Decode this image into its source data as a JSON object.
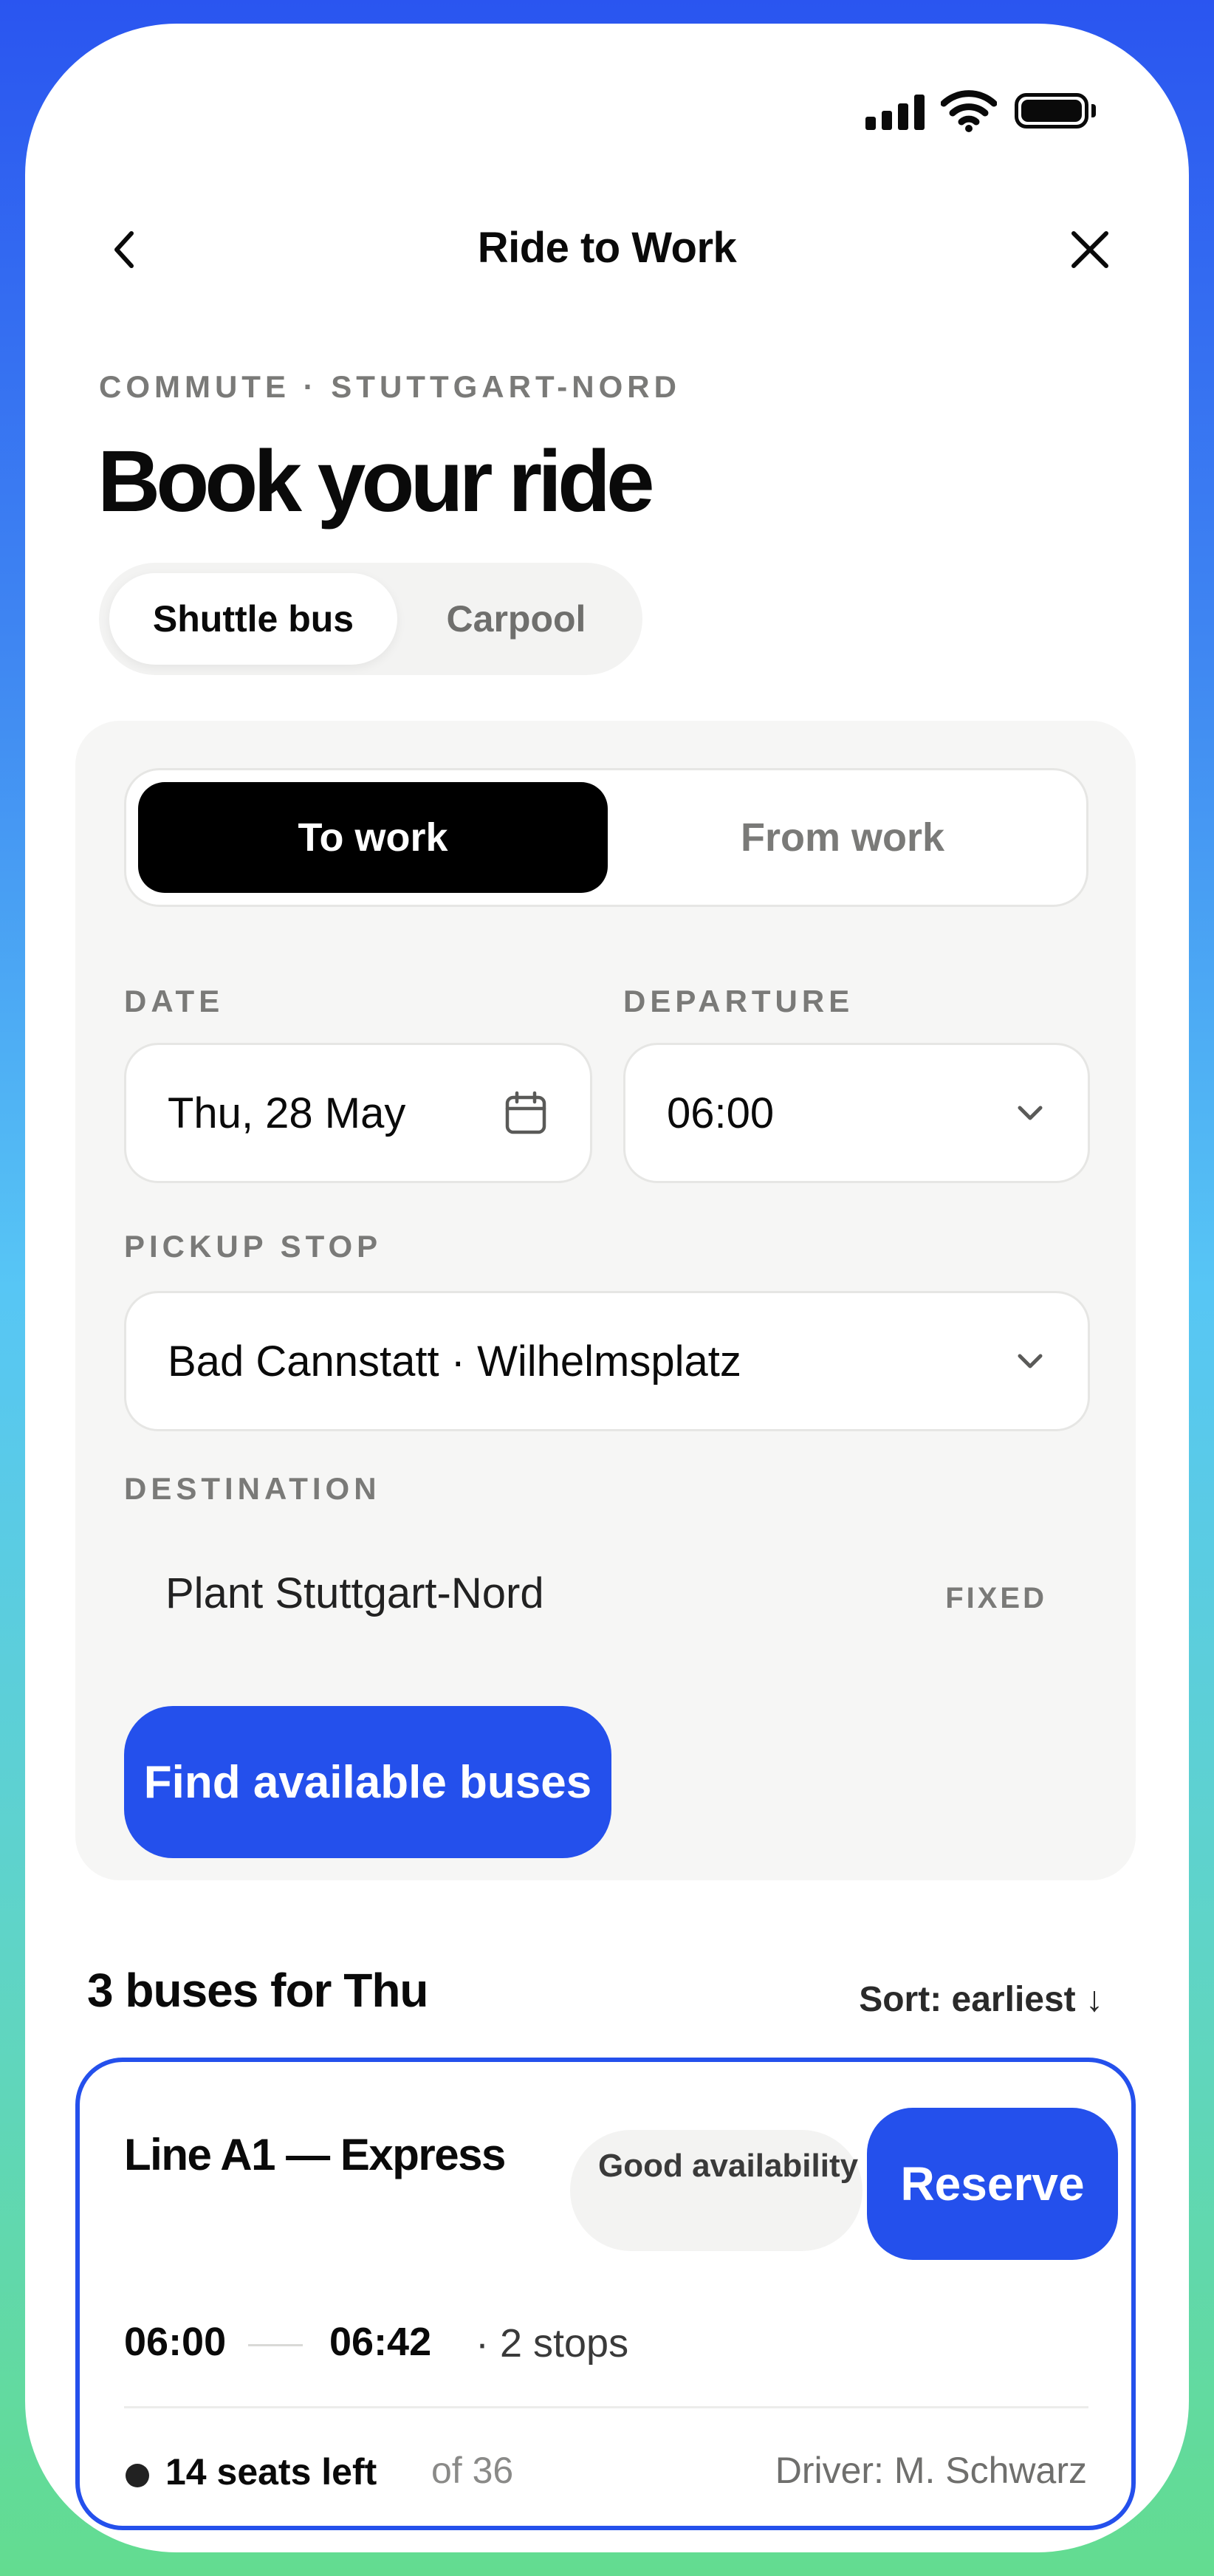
{
  "header": {
    "title": "Ride to Work",
    "back_icon": "chevron-left-icon",
    "close_icon": "close-icon"
  },
  "hero": {
    "eyebrow": "COMMUTE · STUTTGART-NORD",
    "title": "Book your ride"
  },
  "mode_tabs": [
    {
      "label": "Shuttle bus",
      "selected": true
    },
    {
      "label": "Carpool",
      "selected": false
    }
  ],
  "direction": {
    "options": [
      {
        "label": "To work",
        "selected": true
      },
      {
        "label": "From work",
        "selected": false
      }
    ]
  },
  "form": {
    "date_label": "DATE",
    "date_value": "Thu, 28 May",
    "departure_label": "DEPARTURE",
    "departure_value": "06:00",
    "pickup_label": "PICKUP STOP",
    "pickup_value": "Bad Cannstatt · Wilhelmsplatz",
    "destination_label": "DESTINATION",
    "destination_value": "Plant Stuttgart-Nord",
    "destination_badge": "FIXED",
    "submit_label": "Find available buses"
  },
  "results": {
    "title": "3 buses for Thu",
    "sort_label": "Sort: earliest ↓",
    "buses": [
      {
        "name": "Line A1 — Express",
        "availability": "Good availability",
        "reserve_label": "Reserve",
        "depart": "06:00",
        "arrive": "06:42",
        "stops": "· 2 stops",
        "seats_left": "14 seats left",
        "seats_total": "of 36",
        "driver": "Driver: M. Schwarz"
      }
    ]
  },
  "colors": {
    "accent": "#2450ec",
    "frame_top": "#2a55f0",
    "frame_bottom": "#63dc90",
    "muted_text": "#7a7a78"
  }
}
